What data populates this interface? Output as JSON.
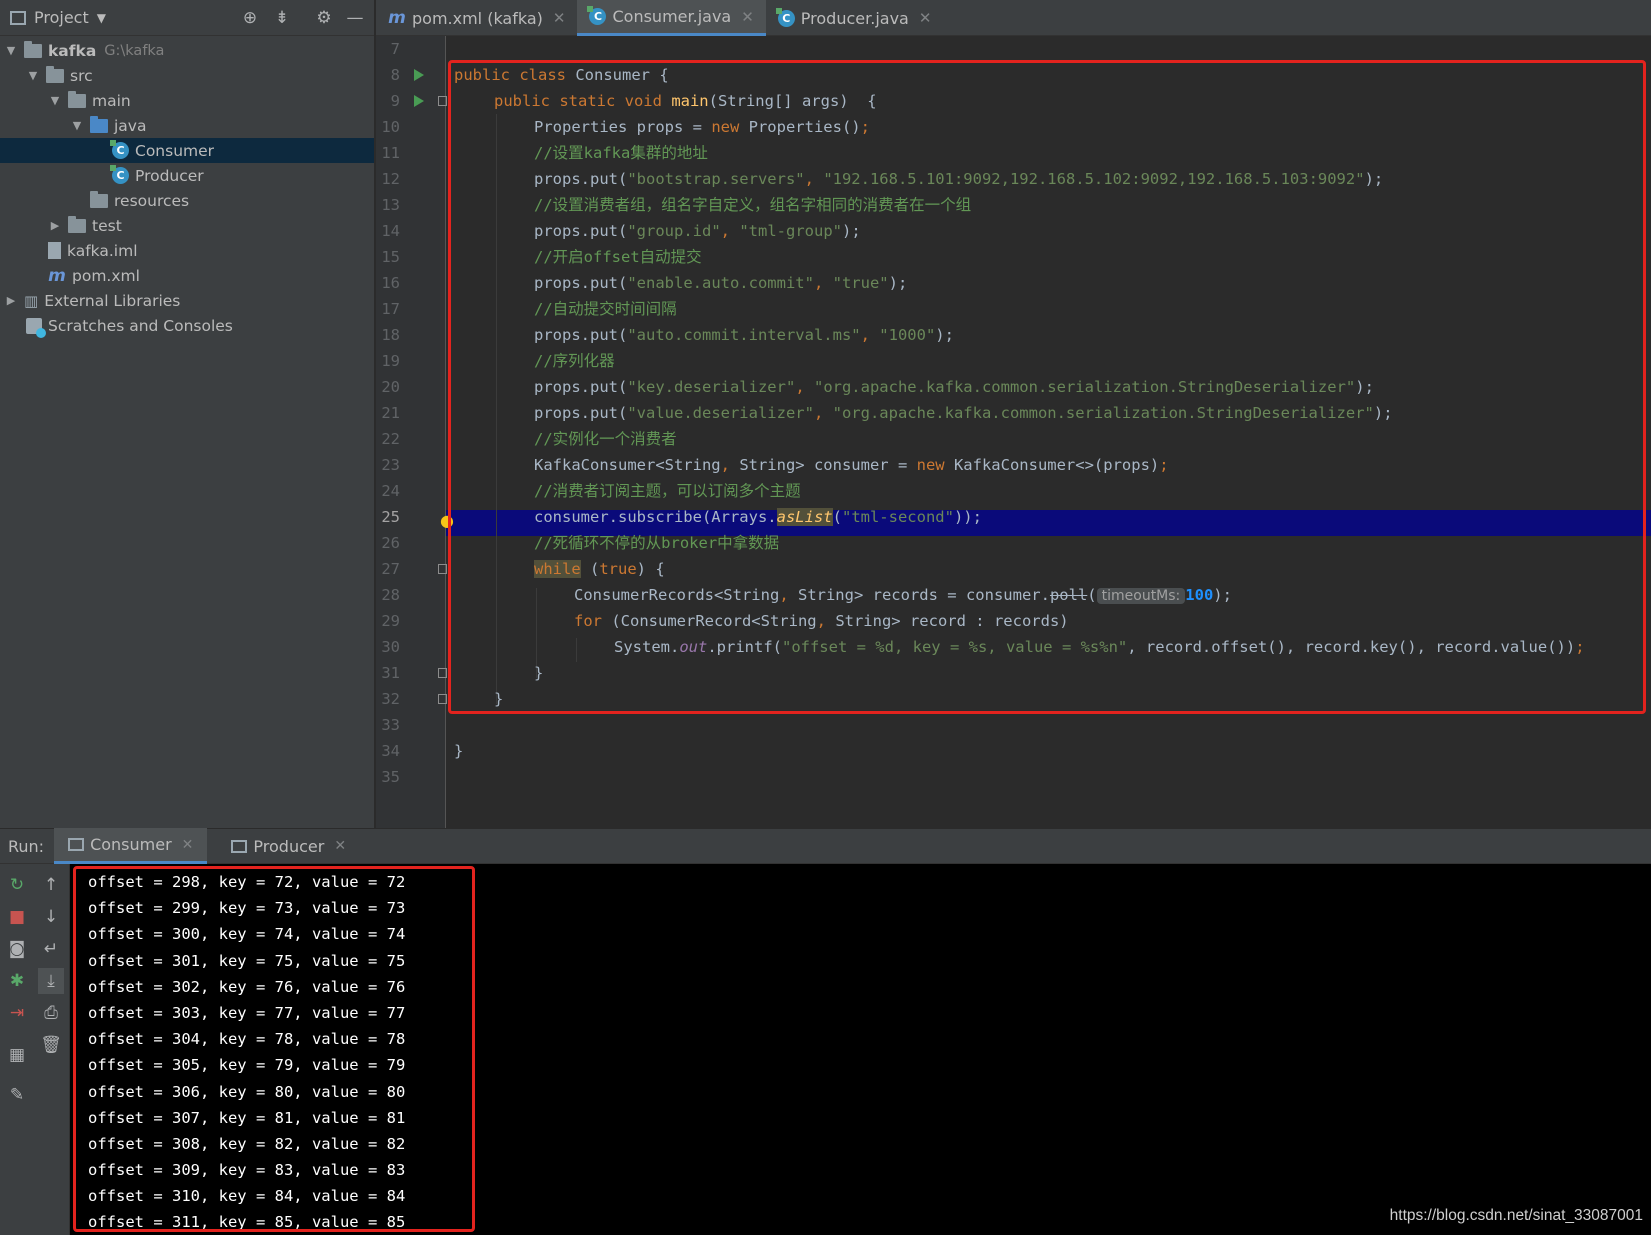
{
  "project_panel": {
    "title": "Project",
    "tree": [
      {
        "label": "kafka",
        "extra": "G:\\kafka"
      },
      {
        "label": "src"
      },
      {
        "label": "main"
      },
      {
        "label": "java"
      },
      {
        "label": "Consumer"
      },
      {
        "label": "Producer"
      },
      {
        "label": "resources"
      },
      {
        "label": "test"
      },
      {
        "label": "kafka.iml"
      },
      {
        "label": "pom.xml"
      },
      {
        "label": "External Libraries"
      },
      {
        "label": "Scratches and Consoles"
      }
    ]
  },
  "editor_tabs": [
    {
      "label": "pom.xml (kafka)"
    },
    {
      "label": "Consumer.java",
      "active": true
    },
    {
      "label": "Producer.java"
    }
  ],
  "editor": {
    "line_numbers": [
      "7",
      "8",
      "9",
      "10",
      "11",
      "12",
      "13",
      "14",
      "15",
      "16",
      "17",
      "18",
      "19",
      "20",
      "21",
      "22",
      "23",
      "24",
      "25",
      "26",
      "27",
      "28",
      "29",
      "30",
      "31",
      "32",
      "33",
      "34",
      "35"
    ],
    "current_line": "25",
    "code": {
      "l8_kw": "public class ",
      "l8_rest": "Consumer {",
      "l9_kw": "public static void ",
      "l9_fn": "main",
      "l9_rest": "(String[] args)  {",
      "l10_a": "Properties props = ",
      "l10_kw": "new ",
      "l10_b": "Properties()",
      "l10_c": ";",
      "l11": "//设置kafka集群的地址",
      "l12_a": "props.put(",
      "l12_s1": "\"bootstrap.servers\"",
      "l12_sep": ", ",
      "l12_s2": "\"192.168.5.101:9092,192.168.5.102:9092,192.168.5.103:9092\"",
      "l12_end": ");",
      "l13": "//设置消费者组，组名字自定义，组名字相同的消费者在一个组",
      "l14_a": "props.put(",
      "l14_s1": "\"group.id\"",
      "l14_sep": ", ",
      "l14_s2": "\"tml-group\"",
      "l14_end": ");",
      "l15": "//开启offset自动提交",
      "l16_a": "props.put(",
      "l16_s1": "\"enable.auto.commit\"",
      "l16_sep": ", ",
      "l16_s2": "\"true\"",
      "l16_end": ");",
      "l17": "//自动提交时间间隔",
      "l18_a": "props.put(",
      "l18_s1": "\"auto.commit.interval.ms\"",
      "l18_sep": ", ",
      "l18_s2": "\"1000\"",
      "l18_end": ");",
      "l19": "//序列化器",
      "l20_a": "props.put(",
      "l20_s1": "\"key.deserializer\"",
      "l20_sep": ", ",
      "l20_s2": "\"org.apache.kafka.common.serialization.StringDeserializer\"",
      "l20_end": ");",
      "l21_a": "props.put(",
      "l21_s1": "\"value.deserializer\"",
      "l21_sep": ", ",
      "l21_s2": "\"org.apache.kafka.common.serialization.StringDeserializer\"",
      "l21_end": ");",
      "l22": "//实例化一个消费者",
      "l23_a": "KafkaConsumer<String",
      "l23_sep": ", ",
      "l23_b": "String> consumer = ",
      "l23_kw": "new ",
      "l23_c": "KafkaConsumer<>(props)",
      "l23_end": ";",
      "l24": "//消费者订阅主题，可以订阅多个主题",
      "l25_a": "consumer.subscribe(Arrays.",
      "l25_m": "asList",
      "l25_b": "(",
      "l25_s": "\"tml-second\"",
      "l25_end": "));",
      "l26": "//死循环不停的从broker中拿数据",
      "l27_kw": "while",
      "l27_a": " (",
      "l27_kw2": "true",
      "l27_b": ") {",
      "l28_a": "ConsumerRecords<String",
      "l28_sep": ", ",
      "l28_b": "String> records = consumer.",
      "l28_poll": "poll",
      "l28_c": "(",
      "l28_hint": "timeoutMs:",
      "l28_num": "100",
      "l28_end": ");",
      "l29_kw": "for ",
      "l29_a": "(ConsumerRecord<String",
      "l29_sep": ", ",
      "l29_b": "String> record : records)",
      "l30_a": "System.",
      "l30_out": "out",
      "l30_b": ".printf(",
      "l30_s": "\"offset = %d, key = %s, value = %s%n\"",
      "l30_c": ", record.offset()",
      "l30_d": ", record.key()",
      "l30_e": ", record.value())",
      "l30_end": ";",
      "l31": "}",
      "l32": "}",
      "l34": "}"
    }
  },
  "run_window": {
    "label": "Run:",
    "tabs": [
      {
        "label": "Consumer",
        "active": true
      },
      {
        "label": "Producer"
      }
    ],
    "console_lines": [
      "offset = 298, key = 72, value = 72",
      "offset = 299, key = 73, value = 73",
      "offset = 300, key = 74, value = 74",
      "offset = 301, key = 75, value = 75",
      "offset = 302, key = 76, value = 76",
      "offset = 303, key = 77, value = 77",
      "offset = 304, key = 78, value = 78",
      "offset = 305, key = 79, value = 79",
      "offset = 306, key = 80, value = 80",
      "offset = 307, key = 81, value = 81",
      "offset = 308, key = 82, value = 82",
      "offset = 309, key = 83, value = 83",
      "offset = 310, key = 84, value = 84",
      "offset = 311, key = 85, value = 85"
    ]
  },
  "watermark": "https://blog.csdn.net/sinat_33087001",
  "colors": {
    "accent": "#4a88c7",
    "highlight_box": "#e3231e",
    "current_line": "#0a0a7a"
  }
}
